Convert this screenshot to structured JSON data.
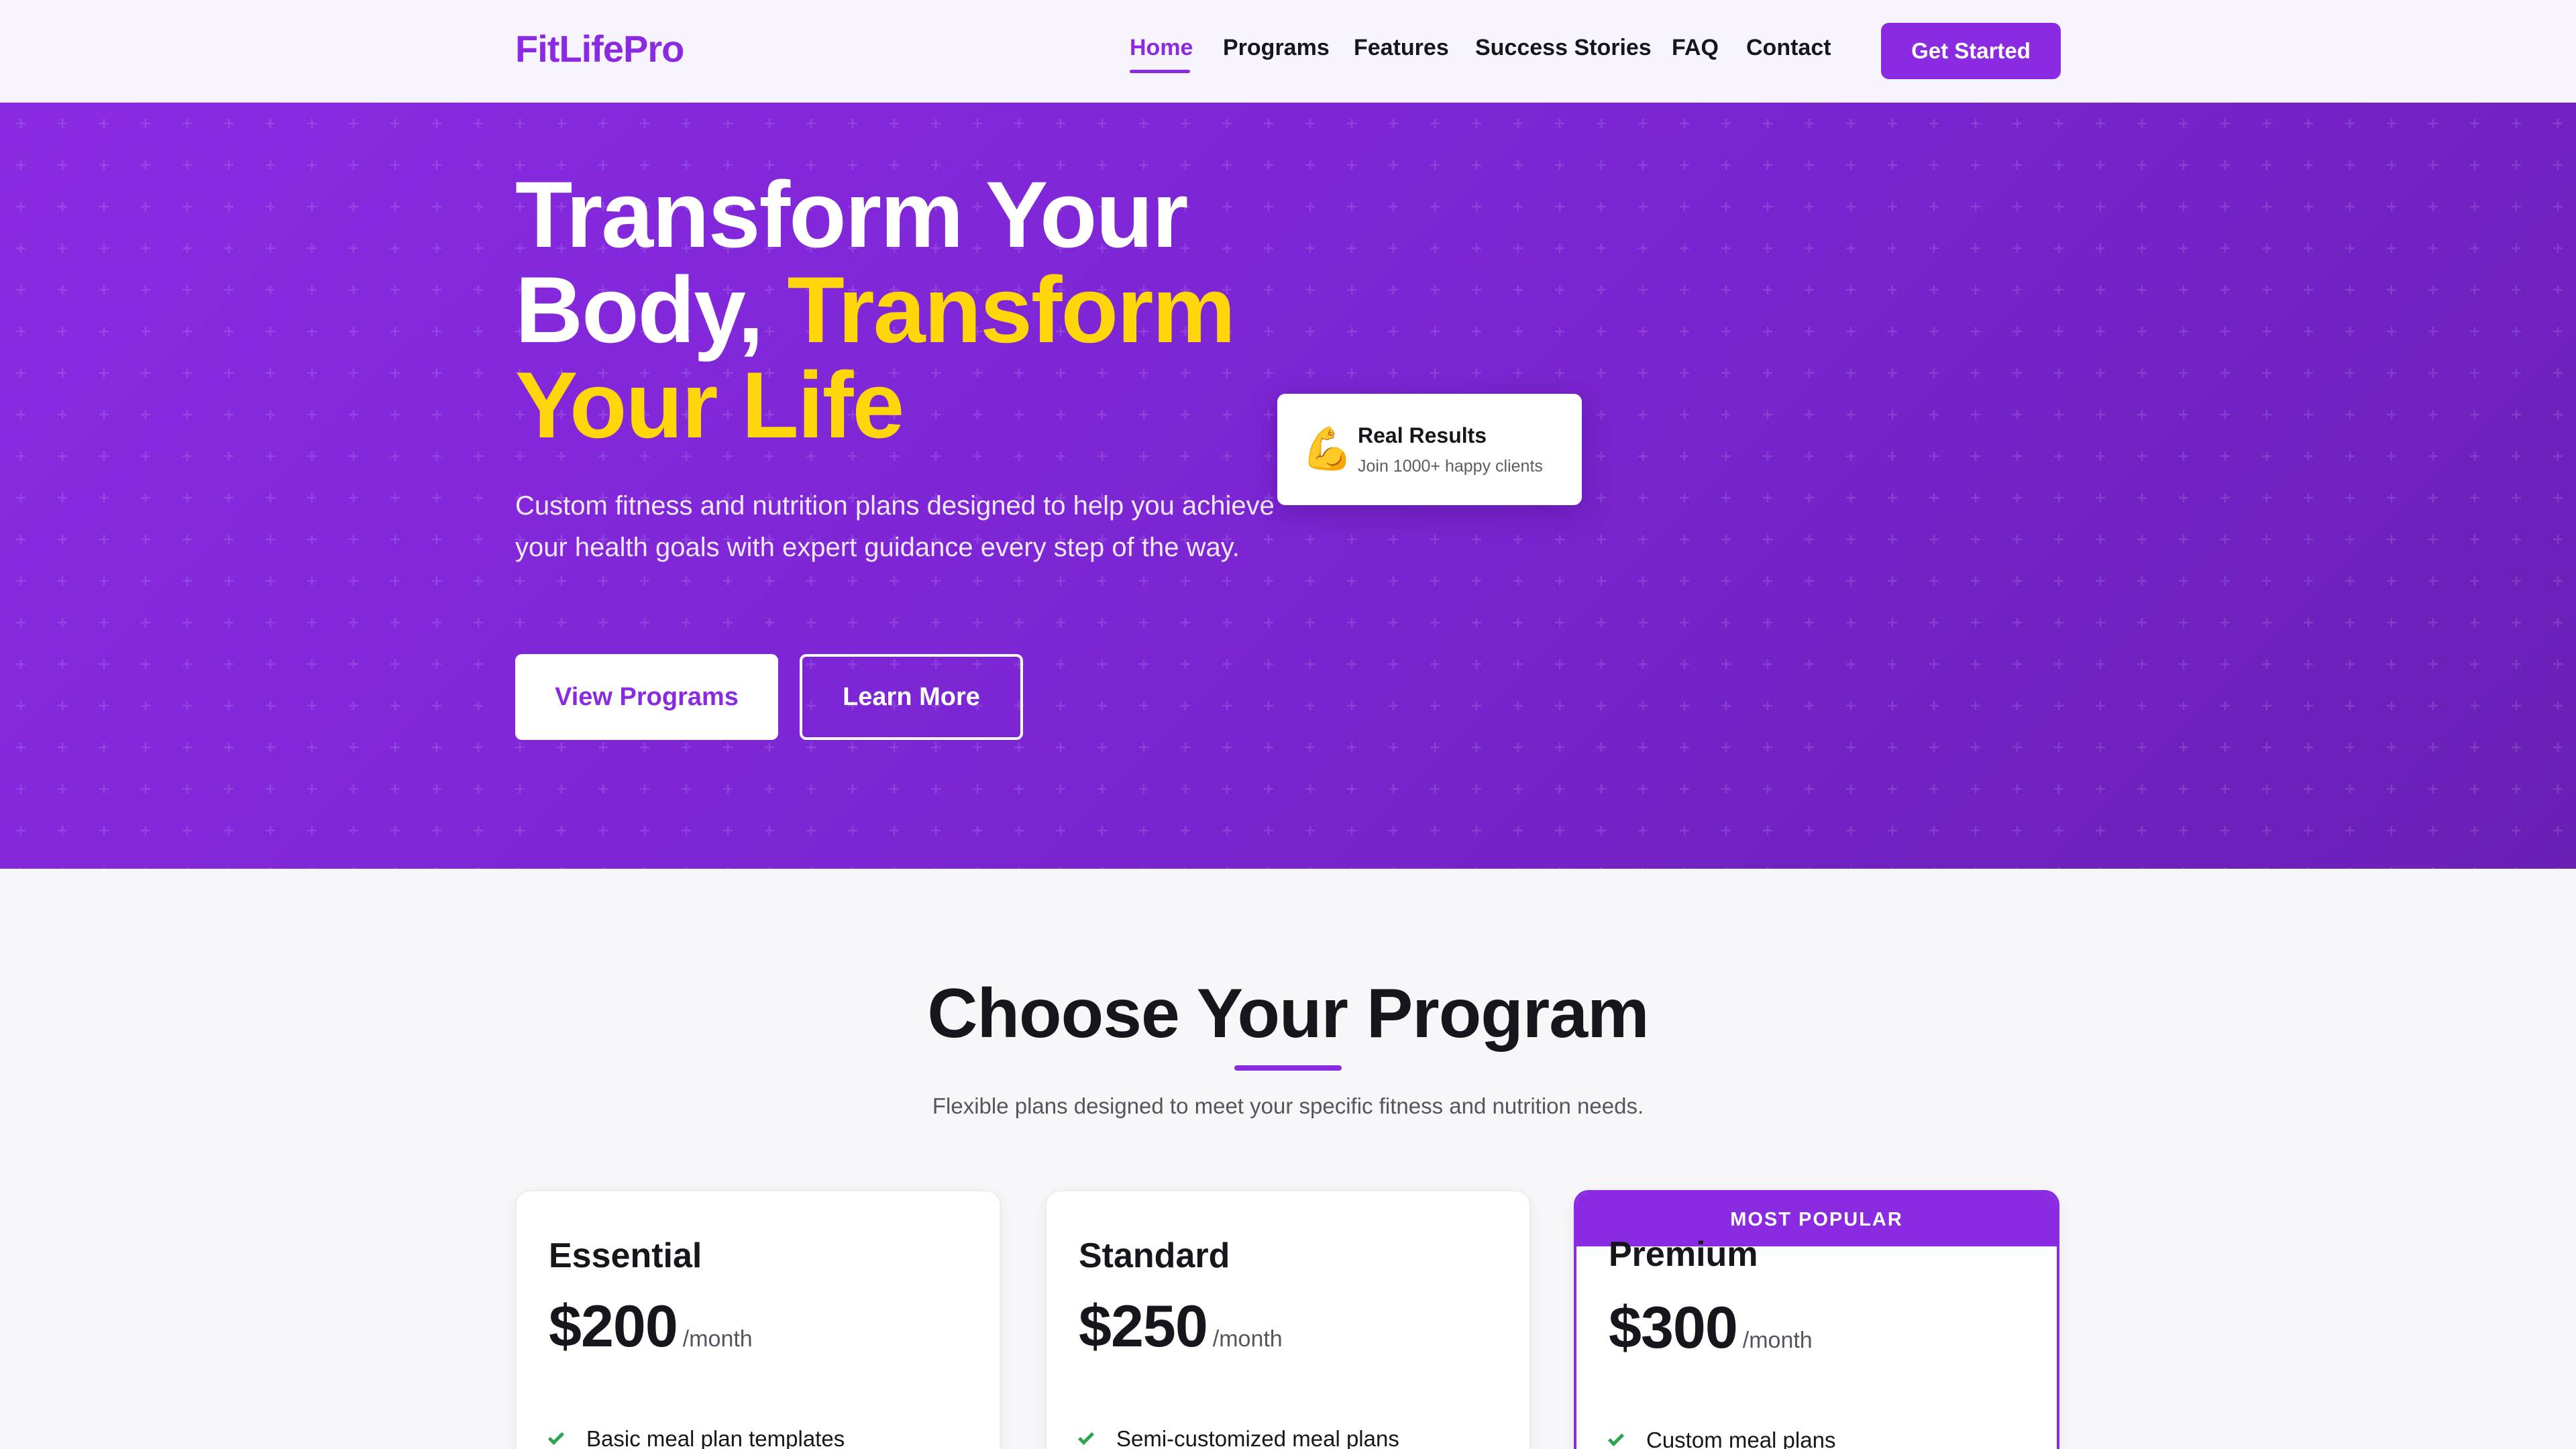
{
  "header": {
    "logo": "FitLifePro",
    "nav": [
      {
        "label": "Home",
        "active": true
      },
      {
        "label": "Programs",
        "active": false
      },
      {
        "label": "Features",
        "active": false
      },
      {
        "label": "Success Stories",
        "active": false
      },
      {
        "label": "FAQ",
        "active": false
      },
      {
        "label": "Contact",
        "active": false
      }
    ],
    "cta_label": "Get Started"
  },
  "hero": {
    "title_line1": "Transform Your",
    "title_line2_white": "Body, ",
    "title_line2_accent": "Transform",
    "title_line3_accent": "Your Life",
    "description": "Custom fitness and nutrition plans designed to help you achieve your health goals with expert guidance every step of the way.",
    "primary_button": "View Programs",
    "secondary_button": "Learn More",
    "results_card": {
      "icon": "flexed-biceps-icon",
      "icon_glyph": "💪",
      "title": "Real Results",
      "subtitle": "Join 1000+ happy clients"
    }
  },
  "programs": {
    "title": "Choose Your Program",
    "subtitle": "Flexible plans designed to meet your specific fitness and nutrition needs.",
    "cards": [
      {
        "name": "Essential",
        "price": "$200",
        "period": "/month",
        "feature": "Basic meal plan templates",
        "badge": ""
      },
      {
        "name": "Standard",
        "price": "$250",
        "period": "/month",
        "feature": "Semi-customized meal plans",
        "badge": ""
      },
      {
        "name": "Premium",
        "price": "$300",
        "period": "/month",
        "feature": "Custom meal plans",
        "badge": "MOST POPULAR"
      }
    ]
  },
  "colors": {
    "brand": "#8a2be2",
    "accent_yellow": "#ffd60a",
    "check_green": "#2ea44f"
  }
}
